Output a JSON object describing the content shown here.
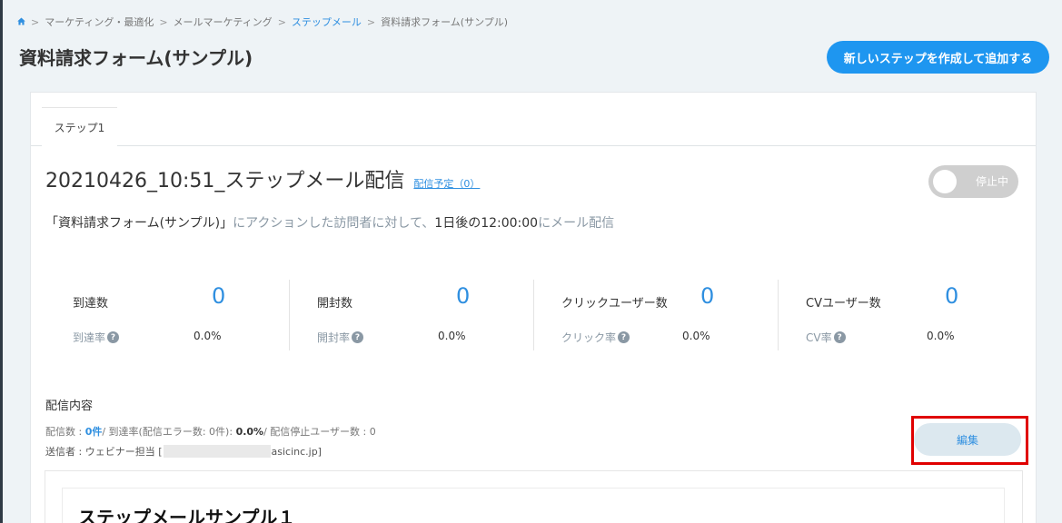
{
  "breadcrumb": {
    "items": [
      {
        "label": "マーケティング・最適化",
        "link": false
      },
      {
        "label": "メールマーケティング",
        "link": false
      },
      {
        "label": "ステップメール",
        "link": true
      },
      {
        "label": "資料請求フォーム(サンプル)",
        "link": false
      }
    ],
    "separator": ">"
  },
  "page": {
    "title": "資料請求フォーム(サンプル)",
    "create_button": "新しいステップを作成して追加する"
  },
  "tabs": [
    {
      "label": "ステップ1"
    }
  ],
  "step": {
    "title": "20210426_10:51_ステップメール配信",
    "schedule_link": "配信予定（0）",
    "toggle_label": "停止中",
    "description": {
      "form_name": "「資料請求フォーム(サンプル)」",
      "part1": "にアクションした訪問者に対して、",
      "timing": "1日後の12:00:00",
      "part2": "にメール配信"
    }
  },
  "stats": [
    {
      "label": "到達数",
      "value": "0",
      "rate_label": "到達率",
      "rate": "0.0%"
    },
    {
      "label": "開封数",
      "value": "0",
      "rate_label": "開封率",
      "rate": "0.0%"
    },
    {
      "label": "クリックユーザー数",
      "value": "0",
      "rate_label": "クリック率",
      "rate": "0.0%"
    },
    {
      "label": "CVユーザー数",
      "value": "0",
      "rate_label": "CV率",
      "rate": "0.0%"
    }
  ],
  "delivery": {
    "section_title": "配信内容",
    "sent_label": "配信数 : ",
    "sent_value": "0件",
    "reach_label": "/ 到達率(配信エラー数: 0件): ",
    "reach_value": "0.0%",
    "stop_label": "/ 配信停止ユーザー数 : 0",
    "sender_label": "送信者 : ウェビナー担当 [",
    "sender_suffix": "asicinc.jp]",
    "edit_button": "編集",
    "preview_heading": "ステップメールサンプル１"
  },
  "colors": {
    "accent": "#1e96f0",
    "link": "#2f8fe0",
    "highlight": "#e00000",
    "toggle_off": "#cfcfcf"
  },
  "icons": {
    "home": "home-icon",
    "help": "help-icon"
  }
}
